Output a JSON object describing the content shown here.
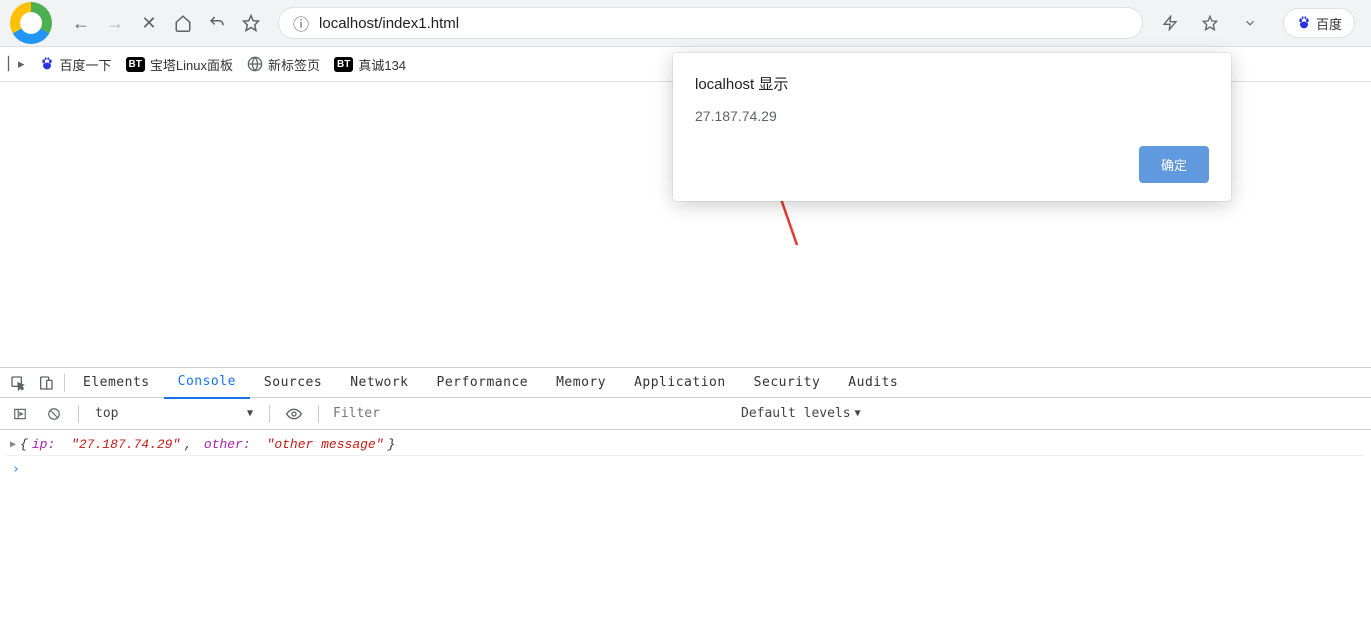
{
  "toolbar": {
    "url": "localhost/index1.html",
    "search_engine_label": "百度"
  },
  "bookmarks": {
    "items": [
      {
        "label": "百度一下",
        "icon": "baidu"
      },
      {
        "label": "宝塔Linux面板",
        "icon": "bt"
      },
      {
        "label": "新标签页",
        "icon": "globe"
      },
      {
        "label": "真诚134",
        "icon": "bt"
      }
    ]
  },
  "alert": {
    "title": "localhost 显示",
    "message": "27.187.74.29",
    "ok_label": "确定"
  },
  "devtools": {
    "tabs": [
      "Elements",
      "Console",
      "Sources",
      "Network",
      "Performance",
      "Memory",
      "Application",
      "Security",
      "Audits"
    ],
    "active_tab": "Console",
    "context": "top",
    "filter_placeholder": "Filter",
    "levels_label": "Default levels",
    "log": {
      "key_ip": "ip:",
      "val_ip": "\"27.187.74.29\"",
      "key_other": "other:",
      "val_other": "\"other message\""
    }
  }
}
